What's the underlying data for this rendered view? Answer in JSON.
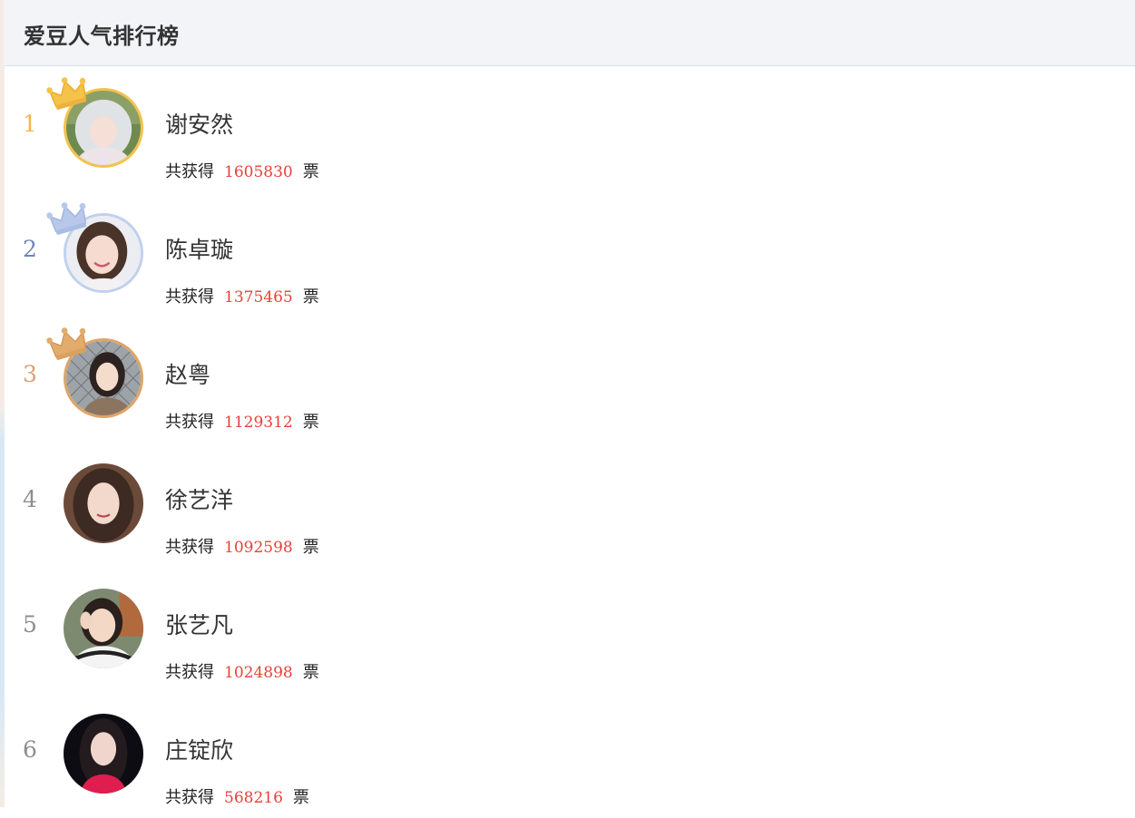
{
  "header": {
    "title": "爱豆人气排行榜"
  },
  "colors": {
    "gold": "#f5c24a",
    "silver": "#a9bfe6",
    "bronze": "#dea566",
    "plain_rank": "#8e8e8e",
    "vote_count": "#e8403a"
  },
  "ranking": [
    {
      "rank": "1",
      "name": "谢安然",
      "votes_prefix": "共获得",
      "votes": "1605830",
      "votes_suffix": "票",
      "crown": "gold-crown-icon"
    },
    {
      "rank": "2",
      "name": "陈卓璇",
      "votes_prefix": "共获得",
      "votes": "1375465",
      "votes_suffix": "票",
      "crown": "silver-crown-icon"
    },
    {
      "rank": "3",
      "name": "赵粤",
      "votes_prefix": "共获得",
      "votes": "1129312",
      "votes_suffix": "票",
      "crown": "bronze-crown-icon"
    },
    {
      "rank": "4",
      "name": "徐艺洋",
      "votes_prefix": "共获得",
      "votes": "1092598",
      "votes_suffix": "票"
    },
    {
      "rank": "5",
      "name": "张艺凡",
      "votes_prefix": "共获得",
      "votes": "1024898",
      "votes_suffix": "票"
    },
    {
      "rank": "6",
      "name": "庄锭欣",
      "votes_prefix": "共获得",
      "votes": "568216",
      "votes_suffix": "票"
    }
  ]
}
